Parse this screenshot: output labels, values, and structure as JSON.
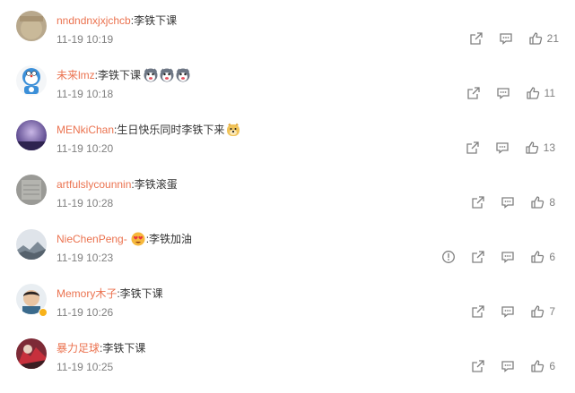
{
  "comments": [
    {
      "username": "nndndnxjxjchcb",
      "text": ":李铁下课",
      "time": "11-19 10:19",
      "likes": "21"
    },
    {
      "username": "未来lmz",
      "text": ":李铁下课",
      "time": "11-19 10:18",
      "likes": "11"
    },
    {
      "username": "MENkiChan",
      "text": ":生日快乐同时李铁下来",
      "time": "11-19 10:20",
      "likes": "13"
    },
    {
      "username": "artfulslycounnin",
      "text": ":李铁滚蛋",
      "time": "11-19 10:28",
      "likes": "8"
    },
    {
      "username": "NieChenPeng-",
      "text": ":李铁加油",
      "time": "11-19 10:23",
      "likes": "6"
    },
    {
      "username": "Memory木子",
      "text": ":李铁下课",
      "time": "11-19 10:26",
      "likes": "7"
    },
    {
      "username": "暴力足球",
      "text": ":李铁下课",
      "time": "11-19 10:25",
      "likes": "6"
    }
  ],
  "colors": {
    "username": "#eb7350",
    "text": "#333333",
    "meta": "#808080"
  }
}
